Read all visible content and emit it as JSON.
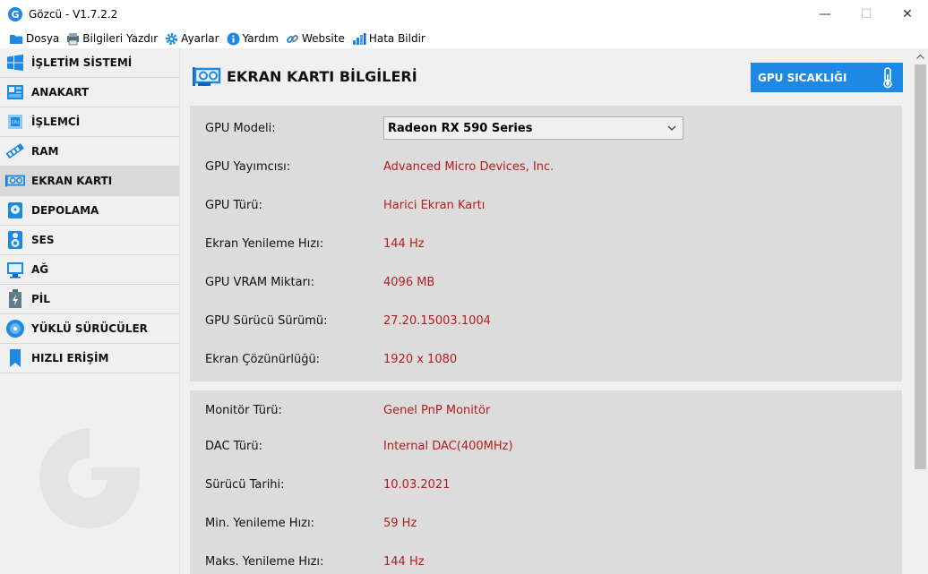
{
  "window": {
    "title": "Gözcü - V1.7.2.2",
    "app_icon_letter": "G",
    "minimize": "—",
    "maximize": "☐",
    "close": "✕"
  },
  "menu": {
    "items": [
      {
        "label": "Dosya",
        "icon": "folder-icon"
      },
      {
        "label": "Bilgileri Yazdır",
        "icon": "print-icon"
      },
      {
        "label": "Ayarlar",
        "icon": "gear-icon"
      },
      {
        "label": "Yardım",
        "icon": "info-icon"
      },
      {
        "label": "Website",
        "icon": "link-icon"
      },
      {
        "label": "Hata Bildir",
        "icon": "bar-chart-icon"
      }
    ]
  },
  "sidebar": {
    "items": [
      {
        "label": "İŞLETİM SİSTEMİ",
        "icon": "windows-icon"
      },
      {
        "label": "ANAKART",
        "icon": "motherboard-icon"
      },
      {
        "label": "İŞLEMCİ",
        "icon": "cpu-icon"
      },
      {
        "label": "RAM",
        "icon": "ram-icon"
      },
      {
        "label": "EKRAN KARTI",
        "icon": "gpu-icon",
        "active": true
      },
      {
        "label": "DEPOLAMA",
        "icon": "disk-icon"
      },
      {
        "label": "SES",
        "icon": "speaker-icon"
      },
      {
        "label": "AĞ",
        "icon": "network-icon"
      },
      {
        "label": "PİL",
        "icon": "battery-icon"
      },
      {
        "label": "YÜKLÜ SÜRÜCÜLER",
        "icon": "driver-disc-icon"
      },
      {
        "label": "HIZLI ERİŞİM",
        "icon": "bookmark-icon"
      }
    ]
  },
  "main": {
    "title": "EKRAN KARTI BİLGİLERİ",
    "temp_button": "GPU SICAKLIĞI",
    "gpu_model_label": "GPU Modeli:",
    "gpu_model_selected": "Radeon RX 590 Series",
    "panel1": [
      {
        "label": "GPU Yayımcısı:",
        "value": "Advanced Micro Devices, Inc."
      },
      {
        "label": "GPU Türü:",
        "value": "Harici Ekran Kartı"
      },
      {
        "label": "Ekran Yenileme Hızı:",
        "value": "144 Hz"
      },
      {
        "label": "GPU VRAM Miktarı:",
        "value": "4096 MB"
      },
      {
        "label": "GPU Sürücü Sürümü:",
        "value": "27.20.15003.1004"
      },
      {
        "label": "Ekran Çözünürlüğü:",
        "value": "1920 x 1080"
      }
    ],
    "panel2": [
      {
        "label": "Monitör Türü:",
        "value": "Genel PnP Monitör"
      },
      {
        "label": "DAC Türü:",
        "value": "Internal DAC(400MHz)"
      },
      {
        "label": "Sürücü Tarihi:",
        "value": "10.03.2021"
      },
      {
        "label": "Min. Yenileme Hızı:",
        "value": "59 Hz"
      },
      {
        "label": "Maks. Yenileme Hızı:",
        "value": "144 Hz"
      }
    ]
  },
  "colors": {
    "accent": "#1e88e5",
    "value_text": "#b71c1c",
    "panel_bg": "#dcdcdc",
    "sidebar_active": "#d9d9d9"
  }
}
